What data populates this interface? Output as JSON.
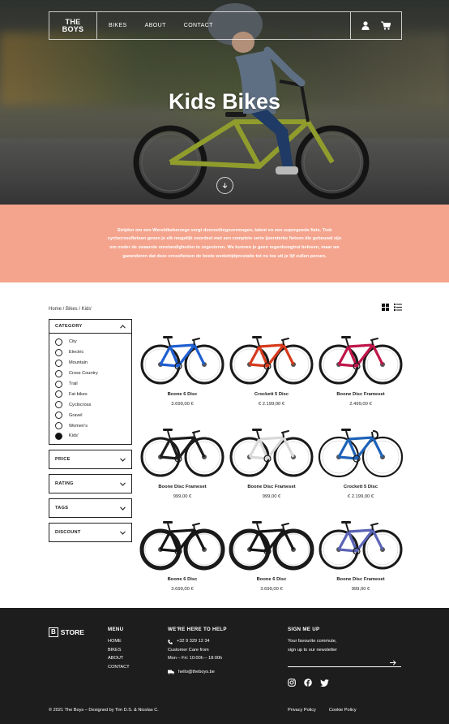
{
  "brand": {
    "logo_line1": "THE",
    "logo_line2": "BOYS"
  },
  "nav": {
    "links": [
      "BIKES",
      "ABOUT",
      "CONTACT"
    ]
  },
  "hero": {
    "title": "Kids Bikes"
  },
  "intro": {
    "text": "Strijden om een Wereldbekerzege vergt doorzettingsvermogen, talent en een supergoede fiets. Trek cyclocrossfietsen geven je elk mogelijk voordeel met een complete serie ijzersterke fietsen die gebouwd zijn om onder de zwaarste omstandigheden te zegevieren. We kunnen je geen regenboogtrui beloven, maar we garanderen dat deze crossfietsen de beste wedstrijdprestatie tot nu toe uit je lijf zullen persen."
  },
  "breadcrumb": "Home / Bikes / Kids'",
  "filters": {
    "category_title": "CATEGORY",
    "categories": [
      "City",
      "Electric",
      "Mountain",
      "Cross Country",
      "Trail",
      "Fat bikes",
      "Cyclocross",
      "Gravel",
      "Women's",
      "Kids'"
    ],
    "selected": "Kids'",
    "others": [
      "PRICE",
      "RATING",
      "TAGS",
      "DISCOUNT"
    ]
  },
  "products": [
    {
      "name": "Boone 6 Disc",
      "price": "3.699,00 €",
      "color": "#1f5fd0",
      "style": "kid"
    },
    {
      "name": "Crockett 5 Disc",
      "price": "€ 2.199,00 €",
      "color": "#d63a1c",
      "style": "kid"
    },
    {
      "name": "Boone Disc Frameset",
      "price": "2.499,00 €",
      "color": "#c0164a",
      "style": "kid"
    },
    {
      "name": "Boone Disc Frameset",
      "price": "999,00 €",
      "color": "#1d1d1d",
      "style": "kid"
    },
    {
      "name": "Boone Disc Frameset",
      "price": "999,00 €",
      "color": "#e8e8e8",
      "style": "kid"
    },
    {
      "name": "Crockett 5 Disc",
      "price": "€ 2.199,00 €",
      "color": "#1e63b8",
      "style": "gravel"
    },
    {
      "name": "Boone 6 Disc",
      "price": "3.699,00 €",
      "color": "#151515",
      "style": "fat"
    },
    {
      "name": "Boone 6 Disc",
      "price": "3.699,00 €",
      "color": "#151515",
      "style": "fat"
    },
    {
      "name": "Boone Disc Frameset",
      "price": "999,00 €",
      "color": "#5a63b5",
      "style": "kid"
    }
  ],
  "footer": {
    "logo_b": "B",
    "logo_text": "STORE",
    "menu_title": "MENU",
    "menu": [
      "HOME",
      "BIKES",
      "ABOUT",
      "CONTACT"
    ],
    "help_title": "WE'RE HERE TO HELP",
    "phone": "+32 9 329 12 34",
    "care_line1": "Customer Care from",
    "care_line2": "Mon – Fri: 10:00h – 18:00h",
    "email": "hello@theboys.be",
    "signup_title": "SIGN ME UP",
    "signup_line1": "Your favourite commute,",
    "signup_line2": "sign up to our newsletter",
    "copyright": "© 2021 The Boys – Designed by Tim D.S. & Nicolas C.",
    "privacy": "Privacy Policy",
    "cookie": "Cookie Policy"
  },
  "colors": {
    "accent": "#f4a48d",
    "footer_bg": "#1d1d1d"
  }
}
